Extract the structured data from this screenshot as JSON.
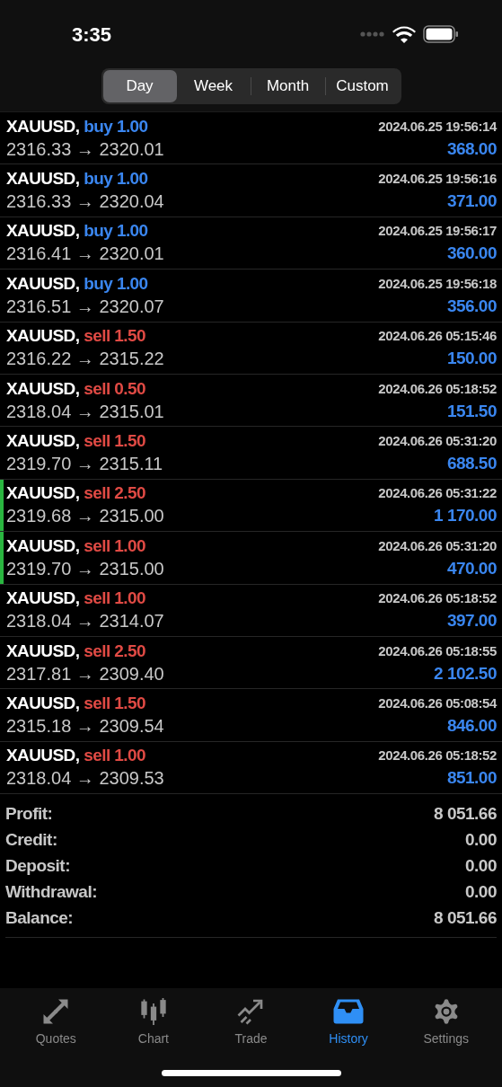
{
  "status_bar": {
    "time": "3:35"
  },
  "periods": [
    {
      "label": "Day",
      "selected": true
    },
    {
      "label": "Week",
      "selected": false
    },
    {
      "label": "Month",
      "selected": false
    },
    {
      "label": "Custom",
      "selected": false
    }
  ],
  "deals": [
    {
      "symbol": "XAUUSD,",
      "kind": "buy",
      "side": "buy 1.00",
      "time": "2024.06.25 19:56:14",
      "prices": "2316.33 → 2320.01",
      "profit": "368.00",
      "selected": false
    },
    {
      "symbol": "XAUUSD,",
      "kind": "buy",
      "side": "buy 1.00",
      "time": "2024.06.25 19:56:16",
      "prices": "2316.33 → 2320.04",
      "profit": "371.00",
      "selected": false
    },
    {
      "symbol": "XAUUSD,",
      "kind": "buy",
      "side": "buy 1.00",
      "time": "2024.06.25 19:56:17",
      "prices": "2316.41 → 2320.01",
      "profit": "360.00",
      "selected": false
    },
    {
      "symbol": "XAUUSD,",
      "kind": "buy",
      "side": "buy 1.00",
      "time": "2024.06.25 19:56:18",
      "prices": "2316.51 → 2320.07",
      "profit": "356.00",
      "selected": false
    },
    {
      "symbol": "XAUUSD,",
      "kind": "sell",
      "side": "sell 1.50",
      "time": "2024.06.26 05:15:46",
      "prices": "2316.22 → 2315.22",
      "profit": "150.00",
      "selected": false
    },
    {
      "symbol": "XAUUSD,",
      "kind": "sell",
      "side": "sell 0.50",
      "time": "2024.06.26 05:18:52",
      "prices": "2318.04 → 2315.01",
      "profit": "151.50",
      "selected": false
    },
    {
      "symbol": "XAUUSD,",
      "kind": "sell",
      "side": "sell 1.50",
      "time": "2024.06.26 05:31:20",
      "prices": "2319.70 → 2315.11",
      "profit": "688.50",
      "selected": false
    },
    {
      "symbol": "XAUUSD,",
      "kind": "sell",
      "side": "sell 2.50",
      "time": "2024.06.26 05:31:22",
      "prices": "2319.68 → 2315.00",
      "profit": "1 170.00",
      "selected": true
    },
    {
      "symbol": "XAUUSD,",
      "kind": "sell",
      "side": "sell 1.00",
      "time": "2024.06.26 05:31:20",
      "prices": "2319.70 → 2315.00",
      "profit": "470.00",
      "selected": true
    },
    {
      "symbol": "XAUUSD,",
      "kind": "sell",
      "side": "sell 1.00",
      "time": "2024.06.26 05:18:52",
      "prices": "2318.04 → 2314.07",
      "profit": "397.00",
      "selected": false
    },
    {
      "symbol": "XAUUSD,",
      "kind": "sell",
      "side": "sell 2.50",
      "time": "2024.06.26 05:18:55",
      "prices": "2317.81 → 2309.40",
      "profit": "2 102.50",
      "selected": false
    },
    {
      "symbol": "XAUUSD,",
      "kind": "sell",
      "side": "sell 1.50",
      "time": "2024.06.26 05:08:54",
      "prices": "2315.18 → 2309.54",
      "profit": "846.00",
      "selected": false
    },
    {
      "symbol": "XAUUSD,",
      "kind": "sell",
      "side": "sell 1.00",
      "time": "2024.06.26 05:18:52",
      "prices": "2318.04 → 2309.53",
      "profit": "851.00",
      "selected": false
    }
  ],
  "summary": [
    {
      "label": "Profit:",
      "value": "8 051.66"
    },
    {
      "label": "Credit:",
      "value": "0.00"
    },
    {
      "label": "Deposit:",
      "value": "0.00"
    },
    {
      "label": "Withdrawal:",
      "value": "0.00"
    },
    {
      "label": "Balance:",
      "value": "8 051.66"
    }
  ],
  "tab_bar": [
    {
      "kind": "quotes",
      "label": "Quotes",
      "selected": false
    },
    {
      "kind": "chart",
      "label": "Chart",
      "selected": false
    },
    {
      "kind": "trade",
      "label": "Trade",
      "selected": false
    },
    {
      "kind": "history",
      "label": "History",
      "selected": true
    },
    {
      "kind": "settings",
      "label": "Settings",
      "selected": false
    }
  ]
}
